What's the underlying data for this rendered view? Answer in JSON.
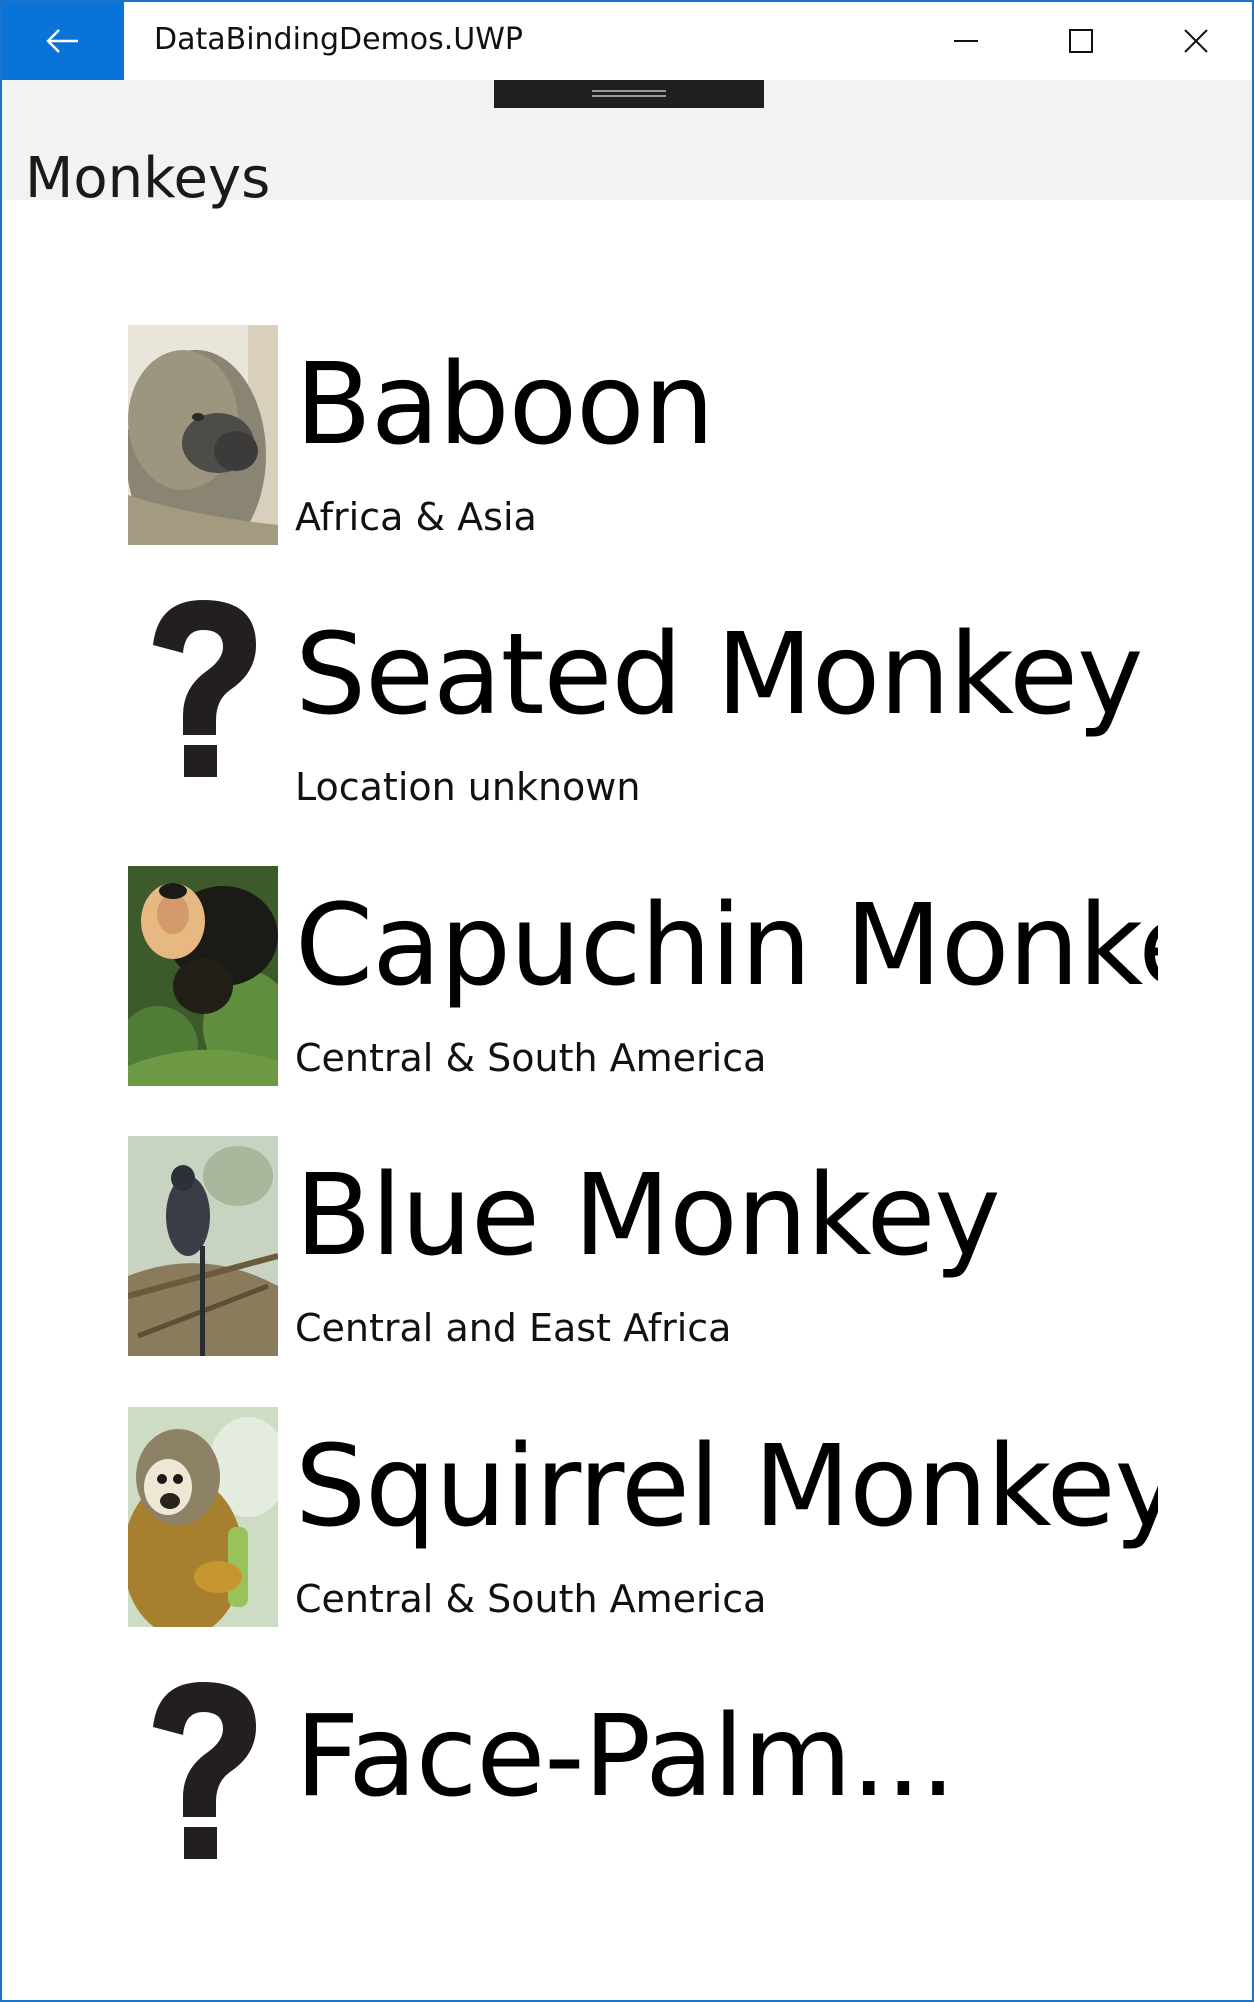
{
  "window": {
    "title": "DataBindingDemos.UWP",
    "accent_color": "#0a73d8"
  },
  "page": {
    "title": "Monkeys"
  },
  "monkeys": [
    {
      "name": "Baboon",
      "location": "Africa & Asia",
      "image": "baboon-photo"
    },
    {
      "name": "Seated Monkey",
      "location": "Location unknown",
      "image": "question-mark-icon"
    },
    {
      "name": "Capuchin Monkey",
      "location": "Central & South America",
      "image": "capuchin-photo"
    },
    {
      "name": "Blue Monkey",
      "location": "Central and East Africa",
      "image": "blue-monkey-photo"
    },
    {
      "name": "Squirrel Monkey",
      "location": "Central & South America",
      "image": "squirrel-monkey-photo"
    },
    {
      "name": "Face-Palm...",
      "location": "",
      "image": "question-mark-icon"
    }
  ]
}
